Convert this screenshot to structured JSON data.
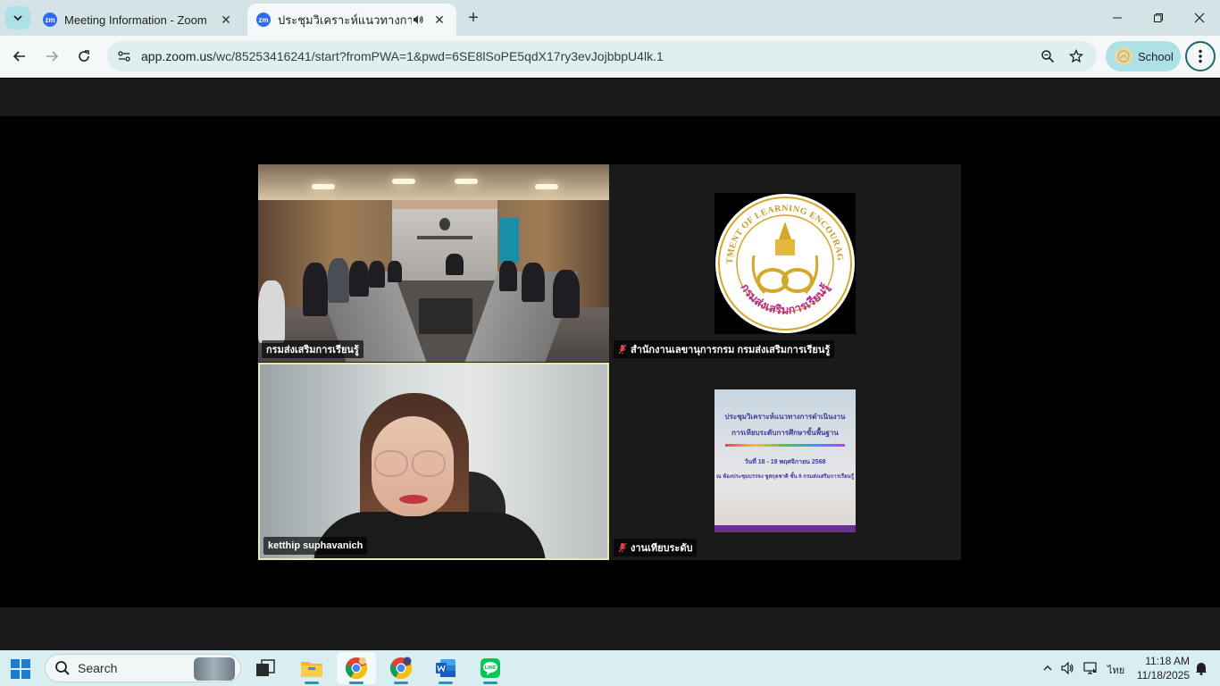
{
  "browser": {
    "tabs": [
      {
        "title": "Meeting Information - Zoom",
        "favicon": "zm",
        "active": false
      },
      {
        "title": "ประชุมวิเคราะห์แนวทางการดำเนินงาน",
        "favicon": "zm",
        "active": true
      }
    ],
    "url_host": "app.zoom.us",
    "url_path": "/wc/85253416241/start?fromPWA=1&pwd=6SE8lSoPE5qdX17ry3evJojbbpU4lk.1",
    "profile_label": "School",
    "icons": [
      "tab-search-icon",
      "speaker-icon",
      "close-icon",
      "new-tab-icon",
      "minimize-icon",
      "restore-icon",
      "window-close-icon",
      "back-icon",
      "forward-icon",
      "reload-icon",
      "site-info-icon",
      "zoom-page-icon",
      "bookmark-star-icon",
      "menu-icon"
    ]
  },
  "meeting": {
    "participants": [
      {
        "name": "กรมส่งเสริมการเรียนรู้",
        "muted": false,
        "view": "camera-room"
      },
      {
        "name": "สำนักงานเลขานุการกรม กรมส่งเสริมการเรียนรู้",
        "muted": true,
        "view": "logo"
      },
      {
        "name": "ketthip suphavanich",
        "muted": false,
        "view": "camera-person",
        "active_speaker": true
      },
      {
        "name": "งานเทียบระดับ",
        "muted": true,
        "view": "slide"
      }
    ],
    "logo_text": {
      "ring": "DEPARTMENT OF LEARNING ENCOURAGEMENT",
      "thai": "กรมส่งเสริมการเรียนรู้"
    },
    "slide": {
      "line1": "ประชุมวิเคราะห์แนวทางการดำเนินงาน",
      "line2": "การเทียบระดับการศึกษาขั้นพื้นฐาน",
      "line3": "วันที่ 18 - 19 พฤศจิกายน 2568",
      "line4": "ณ ห้องประชุมบรรจง ชูสกุลชาติ ชั้น 6 กรมส่งเสริมการเรียนรู้"
    },
    "colors": {
      "active_speaker_border": "#e9eaa5",
      "muted_icon": "#e0404a"
    }
  },
  "taskbar": {
    "search_label": "Search",
    "apps": [
      "task-view",
      "file-explorer",
      "chrome",
      "chrome-profile",
      "word",
      "line"
    ],
    "tray": {
      "language": "ไทย",
      "time": "11:18 AM",
      "date": "11/18/2025"
    }
  }
}
